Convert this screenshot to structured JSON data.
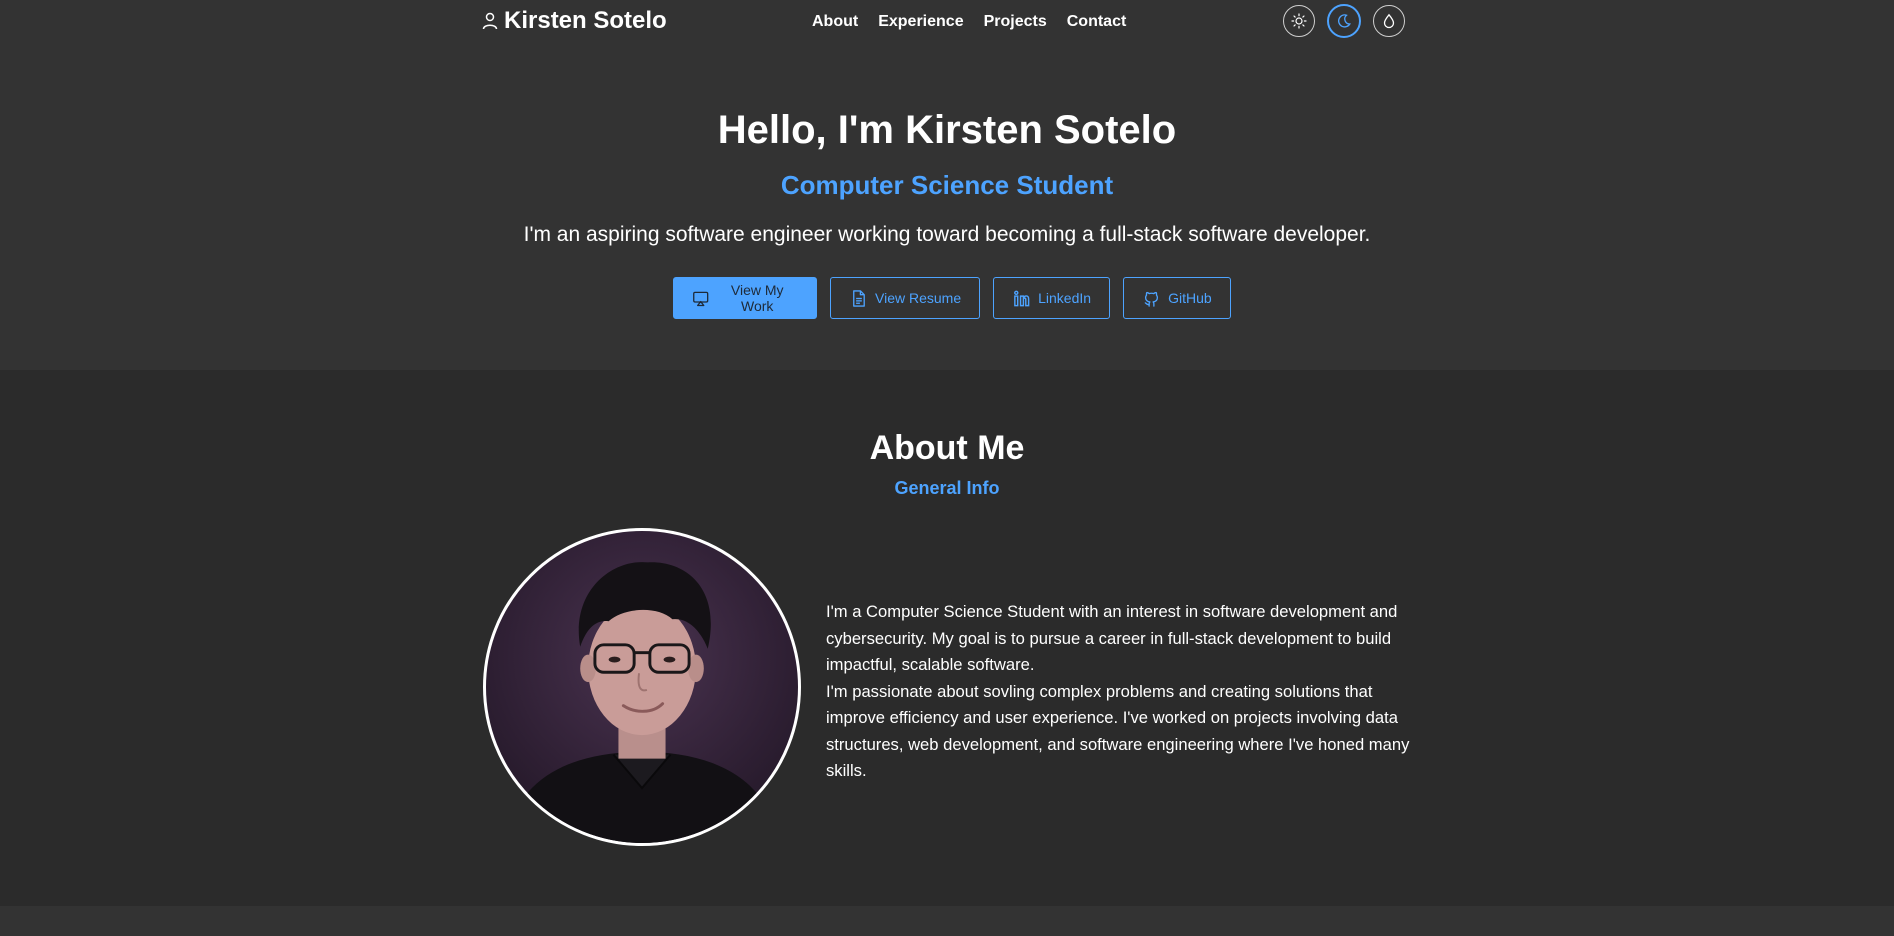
{
  "navbar": {
    "brand_name": "Kirsten Sotelo",
    "brand_icon": "person-icon",
    "links": [
      {
        "label": "About"
      },
      {
        "label": "Experience"
      },
      {
        "label": "Projects"
      },
      {
        "label": "Contact"
      }
    ],
    "theme_toggles": [
      {
        "icon": "sun-icon",
        "active": false
      },
      {
        "icon": "moon-icon",
        "active": true
      },
      {
        "icon": "droplet-icon",
        "active": false
      }
    ]
  },
  "hero": {
    "title": "Hello, I'm Kirsten Sotelo",
    "subtitle": "Computer Science Student",
    "description": "I'm an aspiring software engineer working toward becoming a full-stack software developer.",
    "buttons": [
      {
        "label": "View My Work",
        "icon": "presentation-icon"
      },
      {
        "label": "View Resume",
        "icon": "document-icon"
      },
      {
        "label": "LinkedIn",
        "icon": "linkedin-icon"
      },
      {
        "label": "GitHub",
        "icon": "github-icon"
      }
    ]
  },
  "about": {
    "title": "About Me",
    "subtitle": "General Info",
    "paragraphs": [
      "I'm a Computer Science Student with an interest in software development and cybersecurity. My goal is to pursue a career in full-stack development to build impactful, scalable software.",
      "I'm passionate about sovling complex problems and creating solutions that improve efficiency and user experience. I've worked on projects involving data structures, web development, and software engineering where I've honed many skills."
    ]
  },
  "colors": {
    "accent": "#4da3ff",
    "background": "#333333",
    "section_background": "#2b2b2b",
    "text": "#ffffff"
  }
}
